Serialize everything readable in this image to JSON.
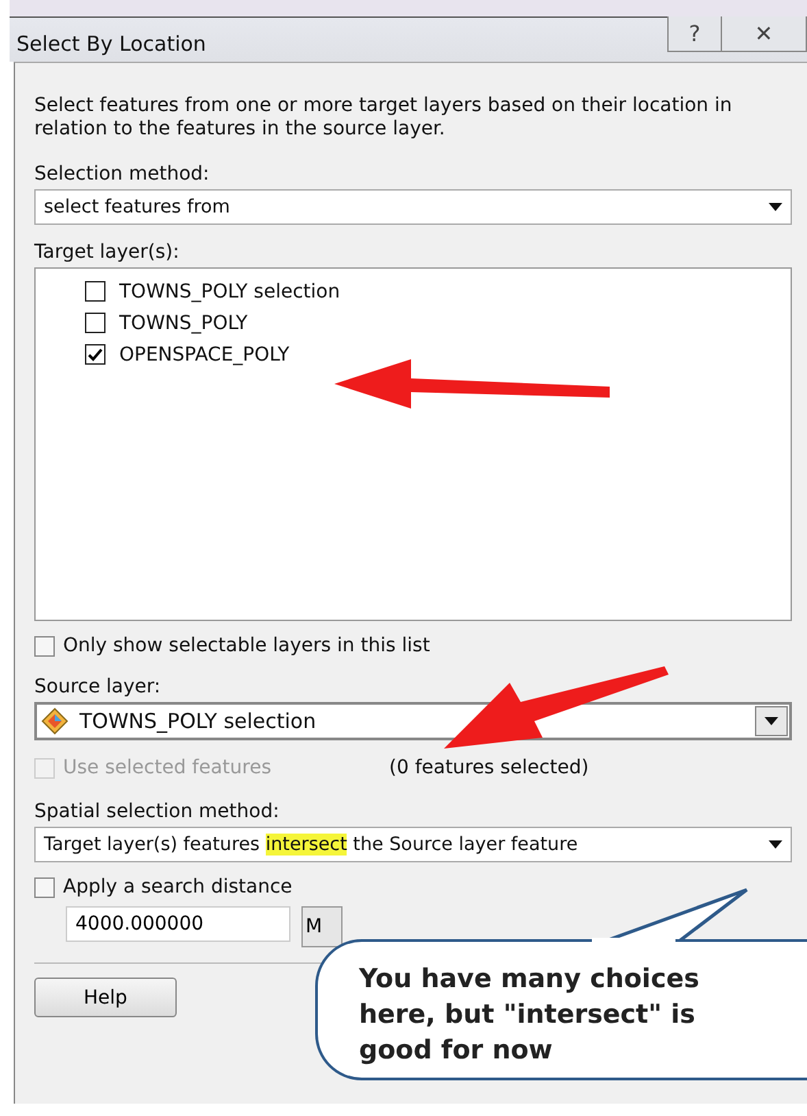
{
  "window": {
    "title": "Select By Location",
    "title_buttons": [
      "?",
      "✕"
    ]
  },
  "description": "Select features from one or more target layers based on their location in relation to the features in the source layer.",
  "selection_method": {
    "label": "Selection method:",
    "value": "select features from"
  },
  "target_layers": {
    "label": "Target layer(s):",
    "items": [
      {
        "name": "TOWNS_POLY selection",
        "checked": false
      },
      {
        "name": "TOWNS_POLY",
        "checked": false
      },
      {
        "name": "OPENSPACE_POLY",
        "checked": true
      }
    ]
  },
  "only_selectable": {
    "label": "Only show selectable layers in this list",
    "checked": false
  },
  "source_layer": {
    "label": "Source layer:",
    "value": "TOWNS_POLY selection"
  },
  "use_selected": {
    "label": "Use selected features",
    "checked": false,
    "disabled": true,
    "count": "(0 features selected)"
  },
  "spatial_method": {
    "label": "Spatial selection method:",
    "segments": [
      {
        "text": "Target layer(s) features ",
        "highlighted": false
      },
      {
        "text": "intersect",
        "highlighted": true
      },
      {
        "text": " the Source layer feature",
        "highlighted": false
      }
    ]
  },
  "search_distance": {
    "label": "Apply a search distance",
    "checked": false,
    "value": "4000.000000",
    "unit": "M"
  },
  "buttons": [
    "Help"
  ],
  "callout": "You have many choices here, but \"intersect\" is good for now"
}
